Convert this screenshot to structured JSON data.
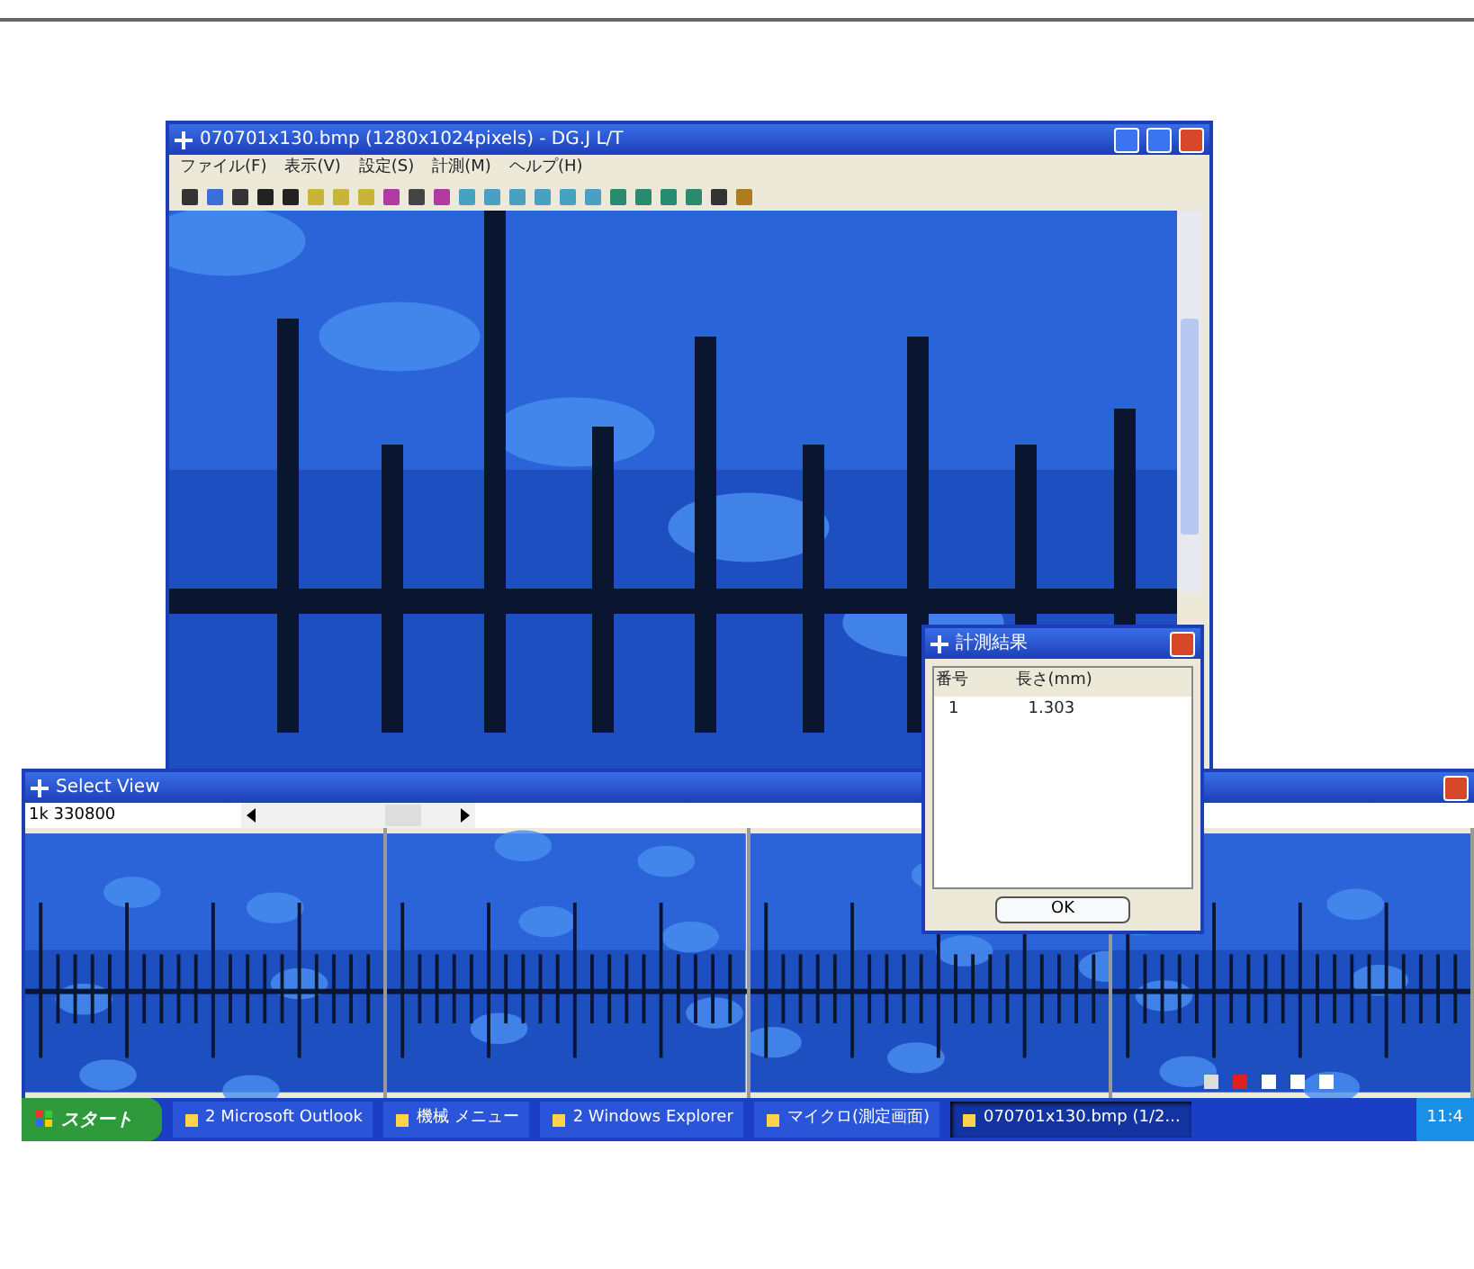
{
  "main_window": {
    "title": "070701x130.bmp (1280x1024pixels) - DG.J L/T",
    "menu": [
      "ファイル(F)",
      "表示(V)",
      "設定(S)",
      "計測(M)",
      "ヘルプ(H)"
    ]
  },
  "select_view": {
    "title": "Select View",
    "field": "1k 330800"
  },
  "result_dialog": {
    "title": "計測結果",
    "columns": [
      "番号",
      "長さ(mm)"
    ],
    "rows": [
      [
        "1",
        "1.303"
      ]
    ],
    "button": "OK"
  },
  "taskbar": {
    "start": "スタート",
    "tasks": [
      {
        "label": "2 Microsoft Outlook",
        "selected": false
      },
      {
        "label": "機械 メニュー",
        "selected": false
      },
      {
        "label": "2 Windows Explorer",
        "selected": false
      },
      {
        "label": "マイクロ(測定画面)",
        "selected": false
      },
      {
        "label": "070701x130.bmp (1/2...",
        "selected": true
      }
    ],
    "clock": "11:4"
  }
}
